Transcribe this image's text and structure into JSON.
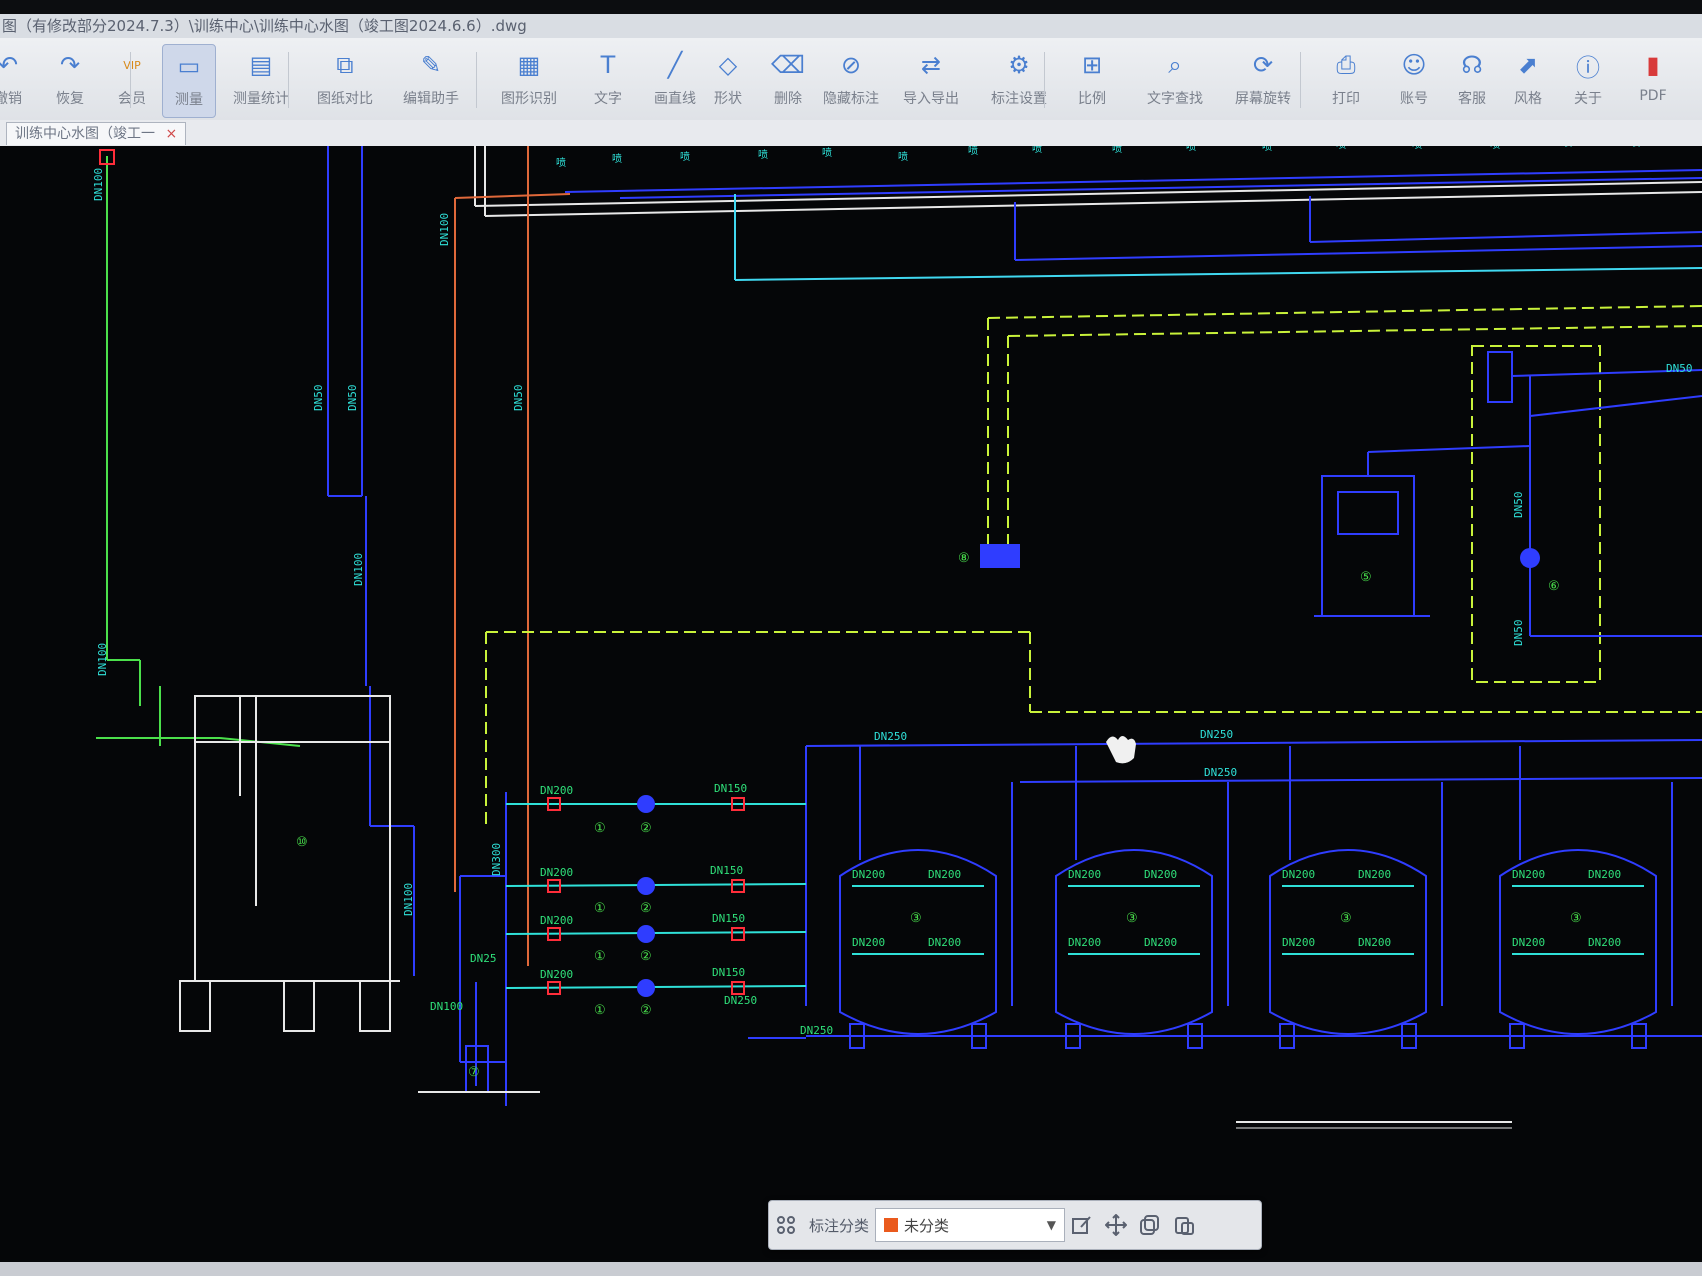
{
  "window": {
    "title": "图（有修改部分2024.7.3）\\训练中心\\训练中心水图（竣工图2024.6.6）.dwg"
  },
  "toolbar": {
    "items": [
      {
        "label": "撤销",
        "icon": "undo-icon"
      },
      {
        "label": "恢复",
        "icon": "redo-icon"
      },
      {
        "label": "会员",
        "icon": "vip-icon"
      },
      {
        "label": "测量",
        "icon": "measure-icon"
      },
      {
        "label": "测量统计",
        "icon": "measure-stats-icon"
      },
      {
        "label": "图纸对比",
        "icon": "compare-icon"
      },
      {
        "label": "编辑助手",
        "icon": "edit-assistant-icon"
      },
      {
        "label": "图形识别",
        "icon": "shape-recognize-icon"
      },
      {
        "label": "文字",
        "icon": "text-icon"
      },
      {
        "label": "画直线",
        "icon": "line-icon"
      },
      {
        "label": "形状",
        "icon": "shape-icon"
      },
      {
        "label": "删除",
        "icon": "eraser-icon"
      },
      {
        "label": "隐藏标注",
        "icon": "hide-annotation-icon"
      },
      {
        "label": "导入导出",
        "icon": "import-export-icon"
      },
      {
        "label": "标注设置",
        "icon": "annotation-settings-icon"
      },
      {
        "label": "比例",
        "icon": "scale-icon"
      },
      {
        "label": "文字查找",
        "icon": "text-search-icon"
      },
      {
        "label": "屏幕旋转",
        "icon": "rotate-screen-icon"
      },
      {
        "label": "打印",
        "icon": "print-icon"
      },
      {
        "label": "账号",
        "icon": "account-icon"
      },
      {
        "label": "客服",
        "icon": "headset-icon"
      },
      {
        "label": "风格",
        "icon": "style-icon"
      },
      {
        "label": "关于",
        "icon": "info-icon"
      },
      {
        "label": "PDF",
        "icon": "pdf-icon"
      }
    ]
  },
  "tab": {
    "label": "训练中心水图（竣工一",
    "close": "×"
  },
  "drawing": {
    "pipe_labels": {
      "dn250": "DN250",
      "dn200": "DN200",
      "dn150": "DN150",
      "dn100": "DN100",
      "dn300": "DN300",
      "dn50": "DN50",
      "dn25": "DN25"
    },
    "filter_tank_numbers": [
      "③",
      "③",
      "③",
      "③"
    ],
    "circle_numbers": {
      "one": "①",
      "two": "②",
      "five": "⑤",
      "six": "⑥",
      "seven": "⑦",
      "eight": "⑧",
      "ten": "⑩"
    },
    "colors": {
      "background": "#050608",
      "water_pipe_blue": "#2f3dff",
      "green_pipe": "#4be04b",
      "yellow_dashed": "#c9f23a",
      "cyan_pipe": "#40d8f0",
      "orange_pipe": "#e0683a",
      "red_valve": "#ff2d3a",
      "white_structure": "#e8e8e8"
    }
  },
  "annotation_bar": {
    "category_label": "标注分类",
    "selected_category": "未分类",
    "category_color": "#ea5a1d"
  }
}
